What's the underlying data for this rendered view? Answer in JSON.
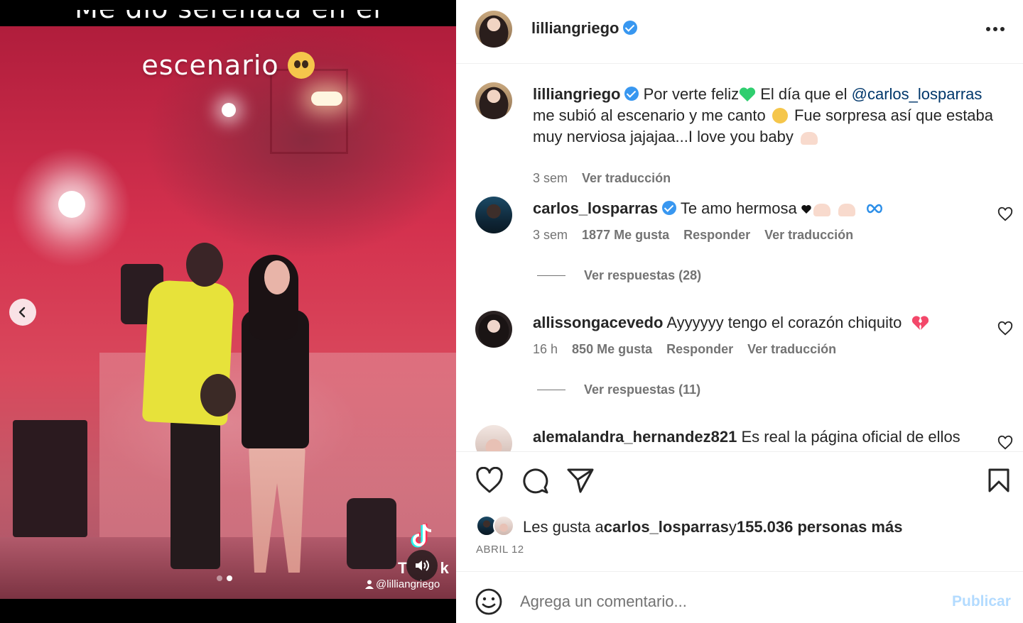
{
  "media": {
    "overlay_line1": "Me dio serenata en el",
    "overlay_line2": "escenario",
    "tiktok_word": "TikTok",
    "tiktok_handle": "@lilliangriego",
    "carousel_count": 2,
    "carousel_active": 2
  },
  "header": {
    "username": "lilliangriego",
    "verified": true
  },
  "caption": {
    "username": "lilliangriego",
    "text_part1": "Por verte feliz",
    "text_part2": " El día que el ",
    "mention": "@carlos_losparras",
    "text_part3": " me subió al escenario y me canto ",
    "text_part4": " Fue sorpresa así que estaba muy nerviosa jajajaa...I love you baby",
    "time": "3 sem",
    "translate": "Ver traducción"
  },
  "comments": [
    {
      "username": "carlos_losparras",
      "verified": true,
      "text": "Te amo hermosa",
      "time": "3 sem",
      "likes": "1877 Me gusta",
      "reply": "Responder",
      "translate": "Ver traducción",
      "replies": "Ver respuestas (28)"
    },
    {
      "username": "allissongacevedo",
      "verified": false,
      "text": "Ayyyyyy tengo el corazón chiquito",
      "time": "16 h",
      "likes": "850 Me gusta",
      "reply": "Responder",
      "translate": "Ver traducción",
      "replies": "Ver respuestas (11)"
    },
    {
      "username": "alemalandra_hernandez821",
      "verified": false,
      "text": "Es real la página oficial de ellos"
    }
  ],
  "likes": {
    "prefix": "Les gusta a ",
    "user": "carlos_losparras",
    "middle": " y ",
    "count": "155.036 personas más"
  },
  "date": "ABRIL 12",
  "composer": {
    "placeholder": "Agrega un comentario...",
    "publish": "Publicar"
  },
  "colors": {
    "verified": "#3897f0",
    "link": "#00376b",
    "muted": "#737373",
    "publish_disabled": "#b3dbff"
  }
}
